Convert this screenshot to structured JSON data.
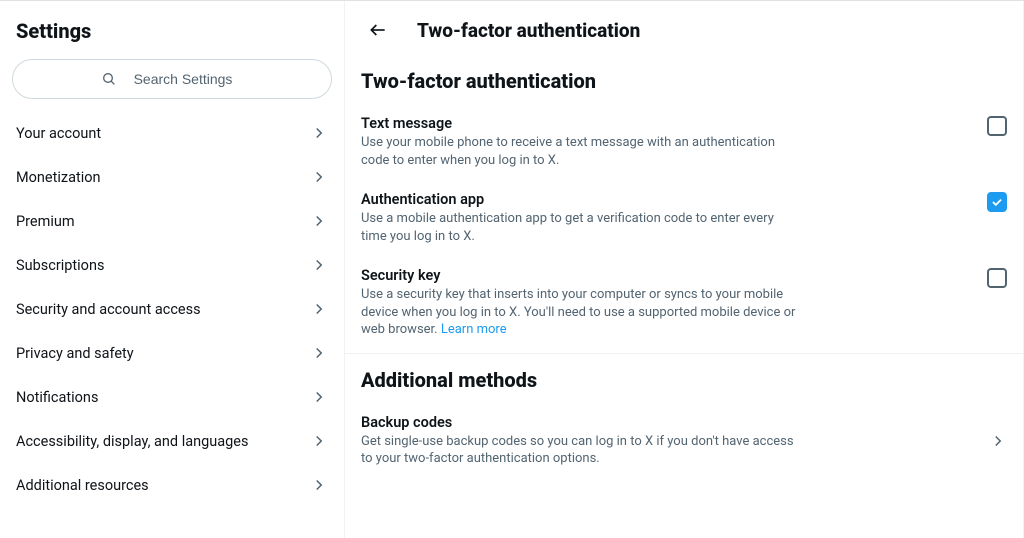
{
  "sidebar": {
    "title": "Settings",
    "search_placeholder": "Search Settings",
    "items": [
      {
        "label": "Your account"
      },
      {
        "label": "Monetization"
      },
      {
        "label": "Premium"
      },
      {
        "label": "Subscriptions"
      },
      {
        "label": "Security and account access"
      },
      {
        "label": "Privacy and safety"
      },
      {
        "label": "Notifications"
      },
      {
        "label": "Accessibility, display, and languages"
      },
      {
        "label": "Additional resources"
      }
    ]
  },
  "main": {
    "header_title": "Two-factor authentication",
    "section1_title": "Two-factor authentication",
    "options": {
      "text_message": {
        "title": "Text message",
        "desc": "Use your mobile phone to receive a text message with an authentication code to enter when you log in to X.",
        "checked": false
      },
      "auth_app": {
        "title": "Authentication app",
        "desc": "Use a mobile authentication app to get a verification code to enter every time you log in to X.",
        "checked": true
      },
      "security_key": {
        "title": "Security key",
        "desc_pre": "Use a security key that inserts into your computer or syncs to your mobile device when you log in to X. You'll need to use a supported mobile device or web browser. ",
        "learn_more": "Learn more",
        "checked": false
      }
    },
    "section2_title": "Additional methods",
    "backup": {
      "title": "Backup codes",
      "desc": "Get single-use backup codes so you can log in to X if you don't have access to your two-factor authentication options."
    }
  }
}
